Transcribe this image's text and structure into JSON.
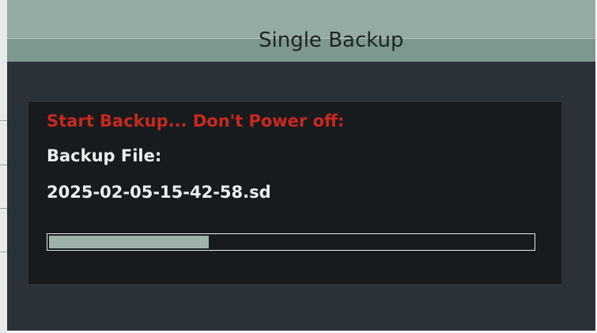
{
  "dialog": {
    "title": "Single Backup",
    "warning": "Start Backup... Don't Power off:",
    "file_label": "Backup File:",
    "file_name": "2025-02-05-15-42-58.sd",
    "progress_fraction": 0.33
  },
  "colors": {
    "title_bar": "#95aaa3",
    "window_bg": "#2b3237",
    "panel_bg": "#171b1d",
    "warning_text": "#c9281f",
    "body_text": "#eceeef",
    "progress_fill": "#9fb2aa"
  }
}
